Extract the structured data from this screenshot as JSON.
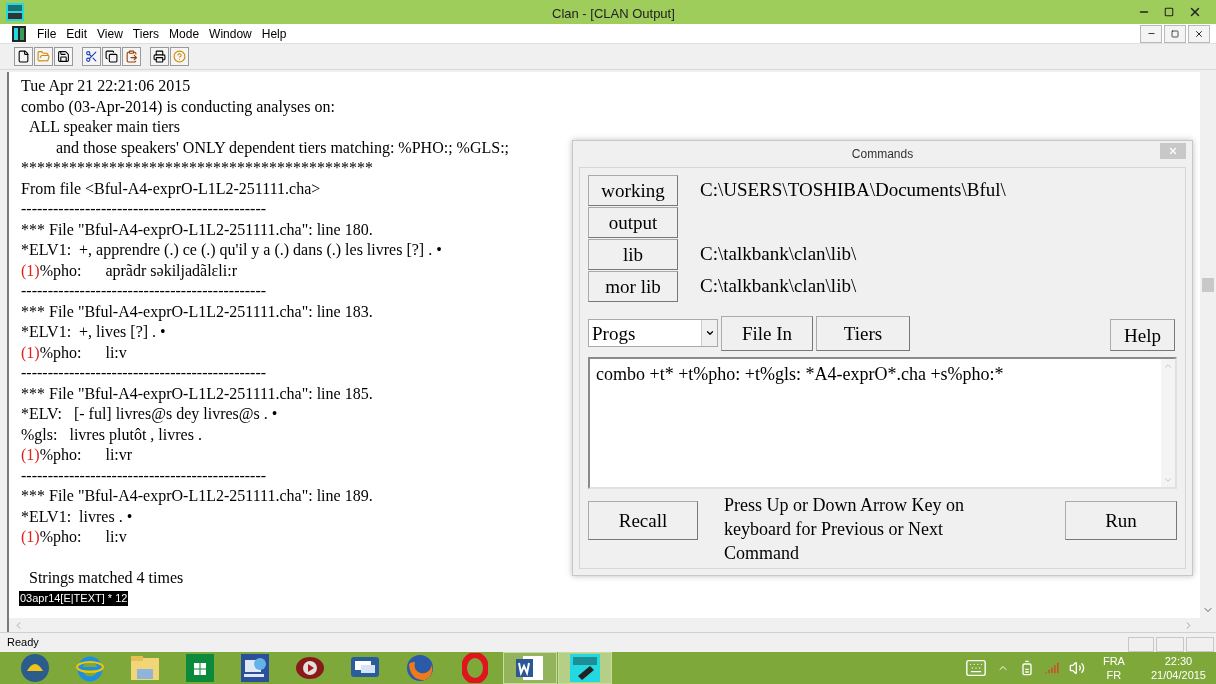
{
  "window": {
    "title": "Clan - [CLAN Output]"
  },
  "menu": [
    "File",
    "Edit",
    "View",
    "Tiers",
    "Mode",
    "Window",
    "Help"
  ],
  "toolbar": [
    {
      "kind": "new"
    },
    {
      "kind": "open"
    },
    {
      "kind": "save"
    },
    {
      "kind": "cut"
    },
    {
      "kind": "copy"
    },
    {
      "kind": "paste"
    },
    {
      "kind": "print"
    },
    {
      "kind": "help"
    }
  ],
  "output": {
    "lines": [
      {
        "kind": "line",
        "text": "Tue Apr 21 22:21:06 2015"
      },
      {
        "kind": "line",
        "text": "combo (03-Apr-2014) is conducting analyses on:"
      },
      {
        "kind": "sub",
        "text": "ALL speaker main tiers"
      },
      {
        "kind": "subsub",
        "text": "and those speakers' ONLY dependent tiers matching: %PHO:; %GLS:;"
      },
      {
        "kind": "line",
        "text": "********************************************"
      },
      {
        "kind": "line",
        "text": "From file <Bful-A4-exprO-L1L2-251111.cha>"
      },
      {
        "kind": "line",
        "text": "----------------------------------------------"
      },
      {
        "kind": "line",
        "text": "*** File \"Bful-A4-exprO-L1L2-251111.cha\": line 180."
      },
      {
        "kind": "line",
        "text": "*ELV1:  +, apprendre (.) ce (.) qu'il y a (.) dans (.) les livres [?] . •"
      },
      {
        "kind": "tier",
        "marker": "(1)",
        "label": "%pho:",
        "value": "aprãdr səkiljadãlɛli:r"
      },
      {
        "kind": "line",
        "text": "----------------------------------------------"
      },
      {
        "kind": "line",
        "text": "*** File \"Bful-A4-exprO-L1L2-251111.cha\": line 183."
      },
      {
        "kind": "line",
        "text": "*ELV1:  +, lives [?] . •"
      },
      {
        "kind": "tier",
        "marker": "(1)",
        "label": "%pho:",
        "value": "li:v"
      },
      {
        "kind": "line",
        "text": "----------------------------------------------"
      },
      {
        "kind": "line",
        "text": "*** File \"Bful-A4-exprO-L1L2-251111.cha\": line 185."
      },
      {
        "kind": "line",
        "text": "*ELV:   [- ful] livres@s dey livres@s . •"
      },
      {
        "kind": "line",
        "text": "%gls:   livres plutôt , livres ."
      },
      {
        "kind": "tier",
        "marker": "(1)",
        "label": "%pho:",
        "value": "li:vr"
      },
      {
        "kind": "line",
        "text": "----------------------------------------------"
      },
      {
        "kind": "line",
        "text": "*** File \"Bful-A4-exprO-L1L2-251111.cha\": line 189."
      },
      {
        "kind": "line",
        "text": "*ELV1:  livres . •"
      },
      {
        "kind": "tier",
        "marker": "(1)",
        "label": "%pho:",
        "value": "li:v"
      },
      {
        "kind": "blank"
      },
      {
        "kind": "sub",
        "text": "Strings matched 4 times"
      },
      {
        "kind": "highlight",
        "text": "03apr14[E|TEXT] * 12"
      }
    ]
  },
  "commands": {
    "title": "Commands",
    "dirs": [
      {
        "label": "working",
        "path": "C:\\USERS\\TOSHIBA\\Documents\\Bful\\"
      },
      {
        "label": "output"
      },
      {
        "label": "lib",
        "path": "C:\\talkbank\\clan\\lib\\"
      },
      {
        "label": "mor lib",
        "path": "C:\\talkbank\\clan\\lib\\"
      }
    ],
    "progs": "Progs",
    "file_in": "File In",
    "tiers": "Tiers",
    "help": "Help",
    "command": "combo +t* +t%pho: +t%gls: *A4-exprO*.cha +s%pho:*",
    "recall": "Recall",
    "hint": "Press Up or Down Arrow Key on keyboard for Previous or Next Command",
    "run": "Run"
  },
  "status_bar": {
    "text": "Ready"
  },
  "taskbar": {
    "apps": [
      {
        "kind": "shell",
        "running": false,
        "selected": false
      },
      {
        "kind": "browser",
        "running": false,
        "selected": false
      },
      {
        "kind": "folder",
        "running": false,
        "selected": false
      },
      {
        "kind": "store",
        "running": false,
        "selected": false
      },
      {
        "kind": "remote",
        "running": false,
        "selected": false
      },
      {
        "kind": "media",
        "running": false,
        "selected": false
      },
      {
        "kind": "chat",
        "running": false,
        "selected": false
      },
      {
        "kind": "firefox",
        "running": false,
        "selected": false
      },
      {
        "kind": "opera",
        "running": false,
        "selected": false
      },
      {
        "kind": "word",
        "running": true,
        "selected": false
      },
      {
        "kind": "clan",
        "running": true,
        "selected": true
      }
    ],
    "language": "FRA",
    "layout": "FR",
    "time": "22:30",
    "date": "21/04/2015"
  }
}
